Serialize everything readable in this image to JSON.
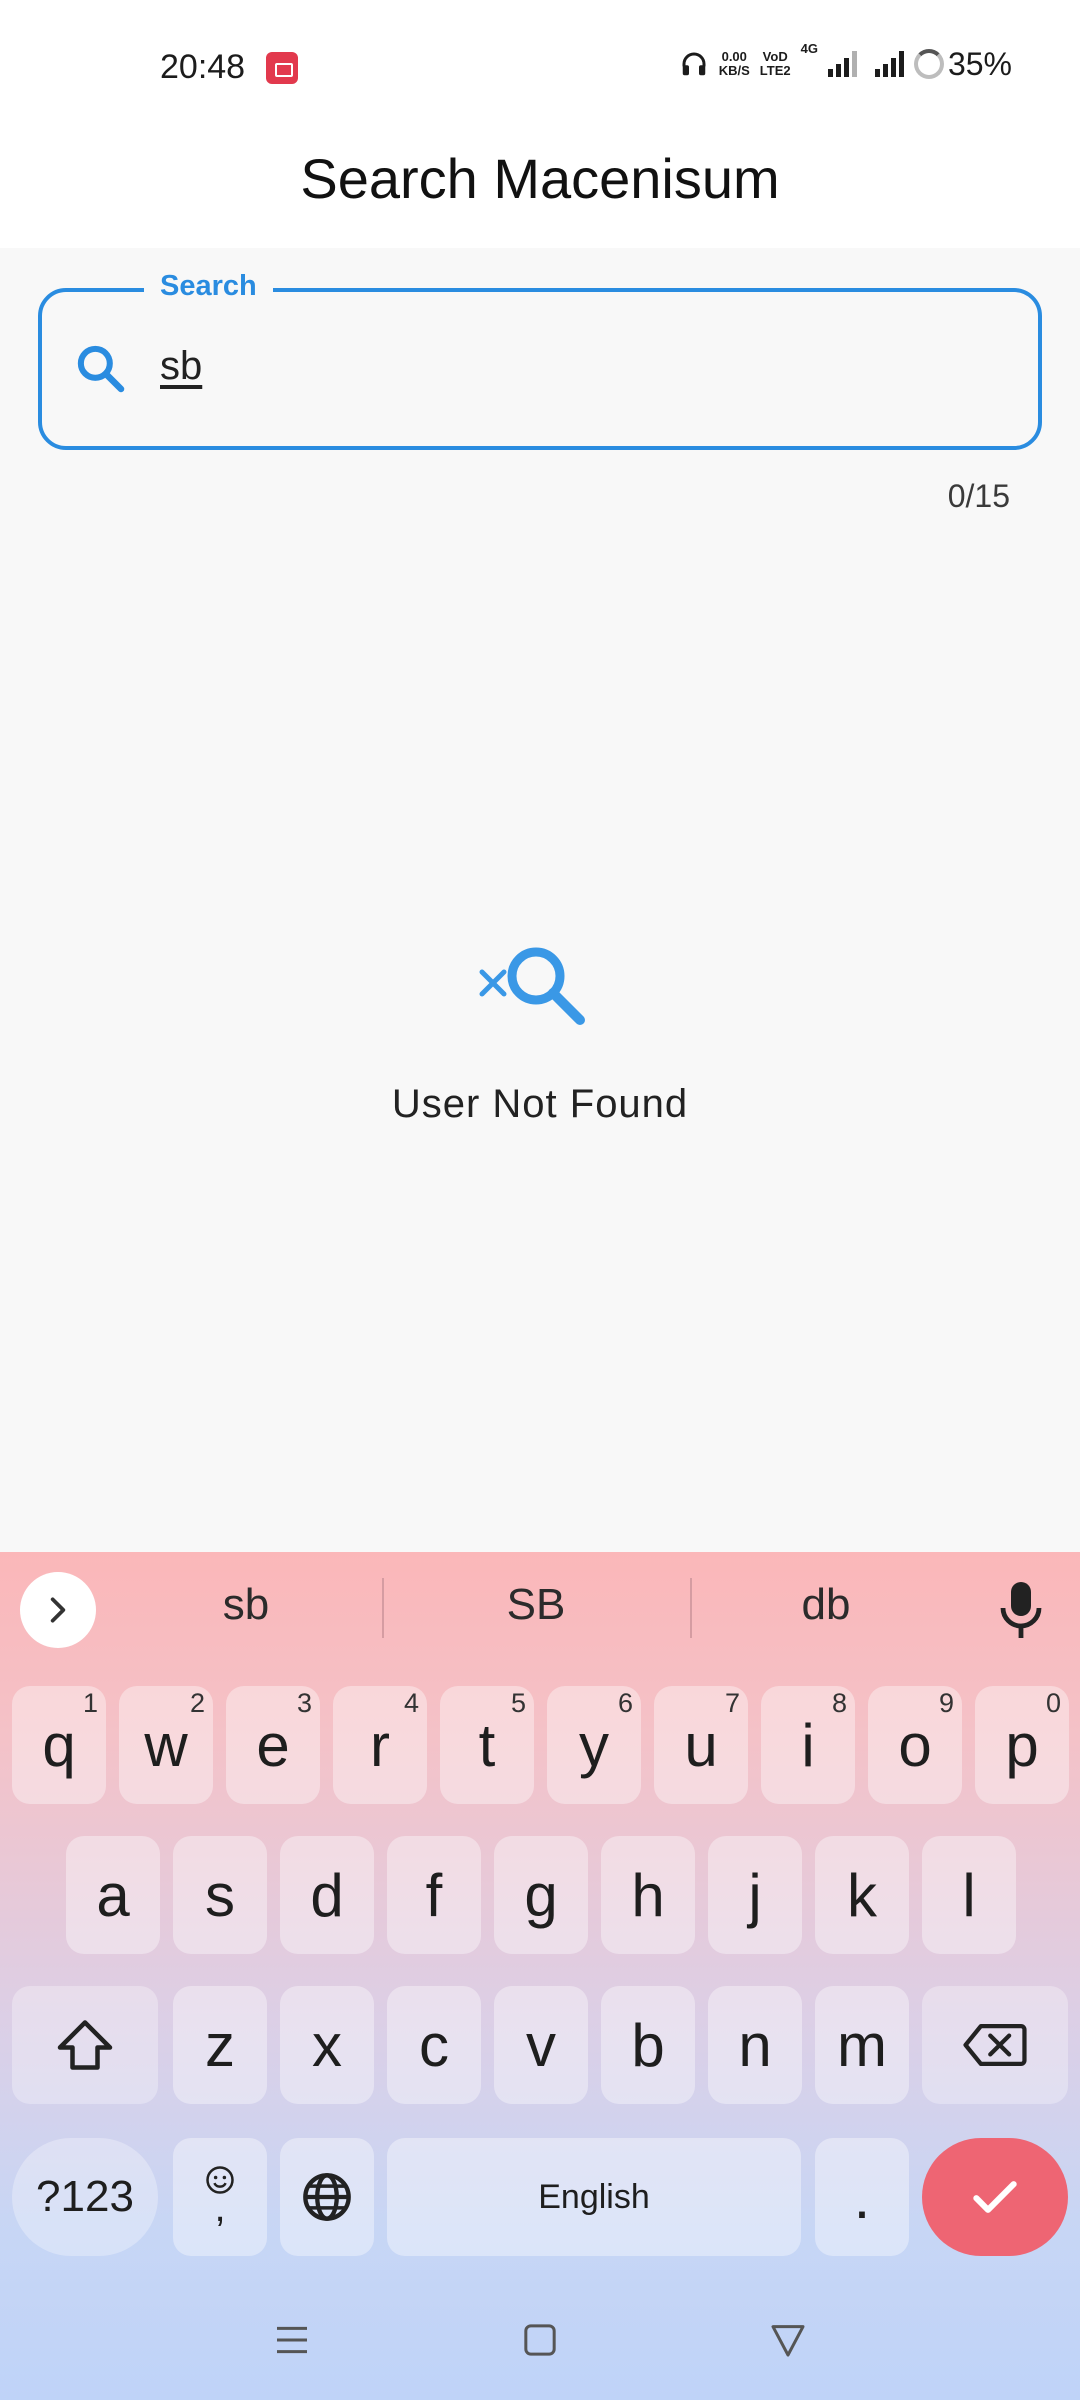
{
  "status_bar": {
    "time": "20:48",
    "net_speed_value": "0.00",
    "net_speed_unit": "KB/S",
    "volte_top": "VoD",
    "volte_bottom": "LTE2",
    "network_type": "4G",
    "battery": "35%",
    "icons": [
      "screen-record-icon",
      "headphones-icon",
      "signal-icon",
      "battery-icon"
    ]
  },
  "app_bar": {
    "title": "Search Macenisum"
  },
  "search": {
    "label": "Search",
    "value": "sb",
    "counter": "0/15",
    "accent_color": "#2a8ce0"
  },
  "empty_state": {
    "icon": "search-off-icon",
    "message": "User Not Found"
  },
  "keyboard": {
    "suggestions": [
      "sb",
      "SB",
      "db"
    ],
    "row1": [
      {
        "key": "q",
        "hint": "1"
      },
      {
        "key": "w",
        "hint": "2"
      },
      {
        "key": "e",
        "hint": "3"
      },
      {
        "key": "r",
        "hint": "4"
      },
      {
        "key": "t",
        "hint": "5"
      },
      {
        "key": "y",
        "hint": "6"
      },
      {
        "key": "u",
        "hint": "7"
      },
      {
        "key": "i",
        "hint": "8"
      },
      {
        "key": "o",
        "hint": "9"
      },
      {
        "key": "p",
        "hint": "0"
      }
    ],
    "row2": [
      "a",
      "s",
      "d",
      "f",
      "g",
      "h",
      "j",
      "k",
      "l"
    ],
    "row3": [
      "z",
      "x",
      "c",
      "v",
      "b",
      "n",
      "m"
    ],
    "symbols_label": "?123",
    "comma_label": ",",
    "space_label": "English",
    "period_label": ".",
    "enter_color": "#ee6573"
  },
  "nav_bar": {
    "icons": [
      "menu-icon",
      "home-icon",
      "back-icon"
    ]
  }
}
